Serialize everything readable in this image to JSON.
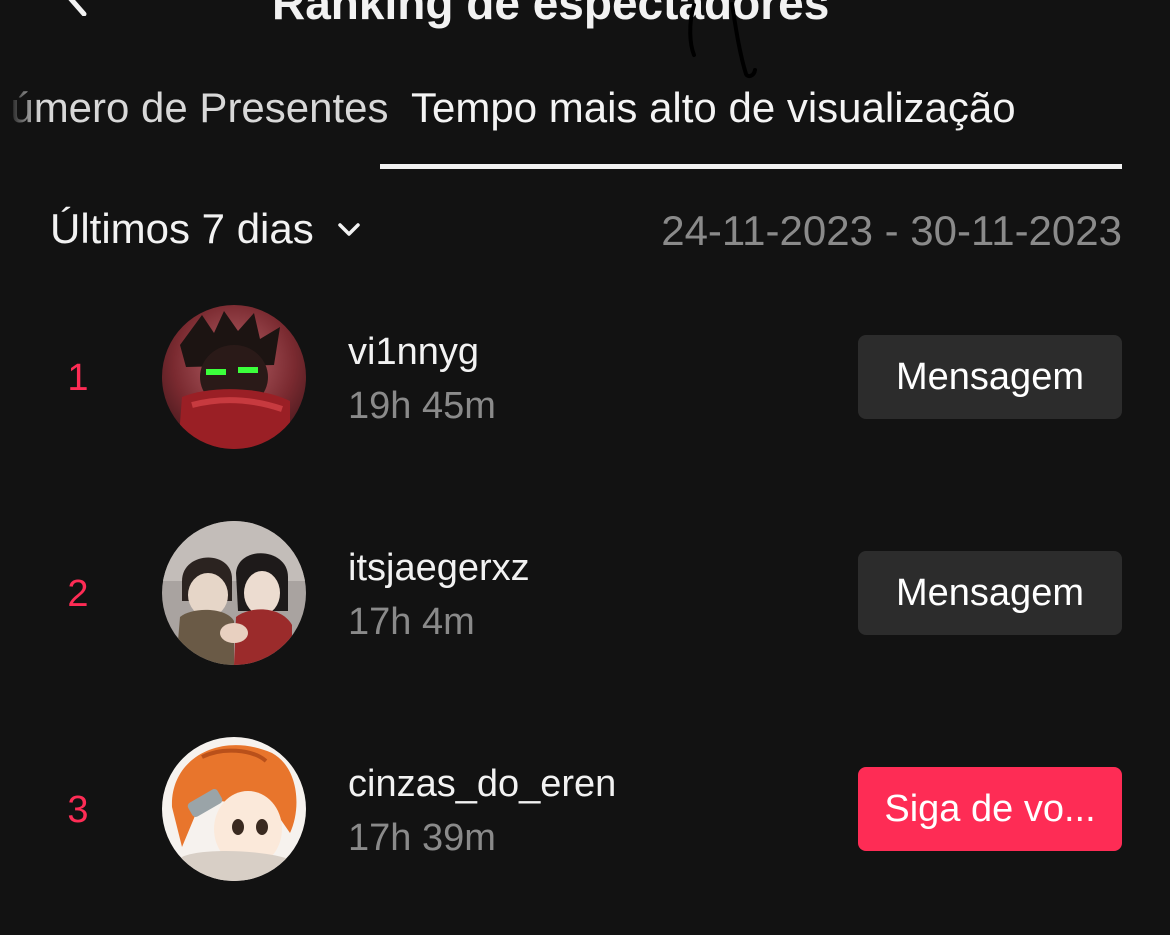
{
  "header": {
    "title": "Ranking de espectadores"
  },
  "tabs": [
    {
      "label": "Número de Presentes",
      "selected": false
    },
    {
      "label": "Tempo mais alto de visualização",
      "selected": true
    }
  ],
  "filter": {
    "period_label": "Últimos 7 dias",
    "date_range": "24-11-2023 - 30-11-2023"
  },
  "ranking": [
    {
      "rank": "1",
      "username": "vi1nnyg",
      "watch_time": "19h 45m",
      "action": "Mensagem"
    },
    {
      "rank": "2",
      "username": "itsjaegerxz",
      "watch_time": "17h 4m",
      "action": "Mensagem"
    },
    {
      "rank": "3",
      "username": "cinzas_do_eren",
      "watch_time": "17h 39m",
      "action": "Siga de vo..."
    }
  ],
  "colors": {
    "background": "#121212",
    "accent": "#fe2c55",
    "secondary_button": "#2c2c2c",
    "muted_text": "#8a8a8a"
  }
}
